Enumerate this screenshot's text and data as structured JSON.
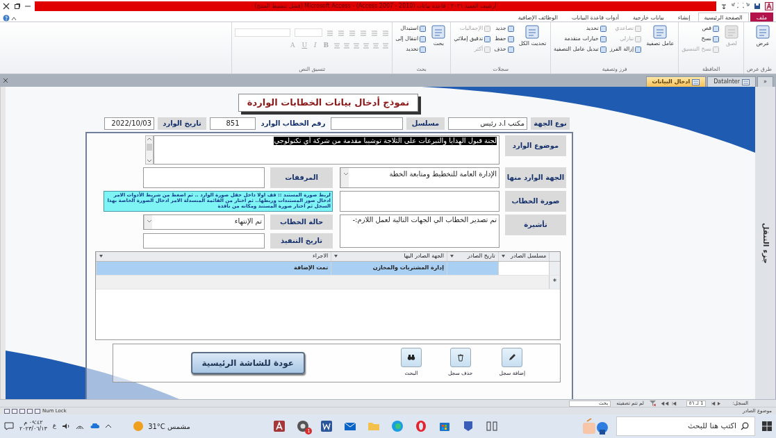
{
  "window": {
    "title": "أرشيف العميد ٢٠٢١ : قاعدة بيانات (Access 2007 - 2010) - Microsoft Access (فشل تنشيط المنتج)"
  },
  "ribbon": {
    "tabs": [
      {
        "label": "ملف",
        "kind": "file",
        "selected": false
      },
      {
        "label": "الصفحة الرئيسية",
        "kind": "tab",
        "selected": true
      },
      {
        "label": "إنشاء",
        "kind": "tab",
        "selected": false
      },
      {
        "label": "بيانات خارجية",
        "kind": "tab",
        "selected": false
      },
      {
        "label": "أدوات قاعدة البيانات",
        "kind": "tab",
        "selected": false
      },
      {
        "label": "الوظائف الإضافية",
        "kind": "tab",
        "selected": false
      }
    ],
    "groups": [
      {
        "label": "طرق عرض",
        "items": [
          {
            "label": "عرض",
            "kind": "large",
            "disabled": false
          }
        ]
      },
      {
        "label": "الحافظة",
        "items": [
          {
            "label": "لصق",
            "kind": "large",
            "disabled": true
          },
          {
            "label": "قص",
            "kind": "small",
            "disabled": false
          },
          {
            "label": "نسخ",
            "kind": "small",
            "disabled": false
          },
          {
            "label": "نسخ التنسيق",
            "kind": "small",
            "disabled": true
          }
        ]
      },
      {
        "label": "فرز وتصفية",
        "items": [
          {
            "label": "عامل تصفية",
            "kind": "large",
            "disabled": false
          },
          {
            "label": "تصاعدي",
            "kind": "small",
            "disabled": true
          },
          {
            "label": "تنازلي",
            "kind": "small",
            "disabled": true
          },
          {
            "label": "إزالة الفرز",
            "kind": "small",
            "disabled": false
          },
          {
            "label": "تحديد",
            "kind": "small",
            "disabled": false
          },
          {
            "label": "خيارات متقدمة",
            "kind": "small",
            "disabled": false
          },
          {
            "label": "تبديل عامل التصفية",
            "kind": "small",
            "disabled": false
          }
        ]
      },
      {
        "label": "سجلات",
        "items": [
          {
            "label": "تحديث الكل",
            "kind": "large",
            "disabled": false
          },
          {
            "label": "جديد",
            "kind": "small",
            "disabled": false
          },
          {
            "label": "حفظ",
            "kind": "small",
            "disabled": false
          },
          {
            "label": "حذف",
            "kind": "small",
            "disabled": false
          },
          {
            "label": "الإجماليات",
            "kind": "small",
            "disabled": true
          },
          {
            "label": "تدقيق إملائي",
            "kind": "small",
            "disabled": false
          },
          {
            "label": "أكثر",
            "kind": "small",
            "disabled": true
          }
        ]
      },
      {
        "label": "بحث",
        "items": [
          {
            "label": "بحث",
            "kind": "large",
            "disabled": false
          },
          {
            "label": "استبدال",
            "kind": "small",
            "disabled": false
          },
          {
            "label": "انتقال إلى",
            "kind": "small",
            "disabled": false
          },
          {
            "label": "تحديد",
            "kind": "small",
            "disabled": false
          }
        ]
      },
      {
        "label": "تنسيق النص",
        "items": [
          {
            "label": "B",
            "kind": "format",
            "disabled": true
          },
          {
            "label": "I",
            "kind": "format",
            "disabled": true
          },
          {
            "label": "U",
            "kind": "format",
            "disabled": true
          },
          {
            "label": "A",
            "kind": "format",
            "disabled": true
          }
        ]
      }
    ]
  },
  "document_tabs": [
    {
      "label": "DataInter",
      "selected": false
    },
    {
      "label": "ادخال البيانات",
      "selected": true
    }
  ],
  "shutter_toggle": "«",
  "form": {
    "title": "نموذج أدخال بيانات الخطابات الواردة",
    "header_fields": [
      {
        "label": "نوع الجهة",
        "value": "مكتب ا.د رئيس"
      },
      {
        "label": "مسلسل"
      },
      {
        "label": "رقم الخطاب الوارد",
        "value": "851"
      },
      {
        "label": "تاريخ الوارد",
        "value": "2022/10/03"
      }
    ],
    "field_rows": [
      [
        {
          "kind": "memo",
          "label": "موضوع الوارد",
          "value": "لجنة قبول الهدايا والتبرعات على الثلاجة توشيبا مقدمة من شركة أي تكنولوجي",
          "selected": true
        }
      ],
      [
        {
          "kind": "combo",
          "label": "الجهة الوارد منها",
          "value": "الإدارة العامة للتخطيط ومتابعة الخطة"
        },
        {
          "kind": "text",
          "label": "المرفقات"
        }
      ],
      [
        {
          "kind": "text",
          "label": "صورة الخطاب"
        },
        {
          "kind": "hint",
          "text": "لربط صورة المستند :: قف اولا داخل حقل صورة الوارد .. ثم اضغط من شريط الأدوات الامر ادخال صور المستندات وربطها.. ثم اختار من القائمة المنسدلة الامر ادخال الصورة الخاصة بهذا السجل ثم اختار صورة المستند ومكانه من نافذة"
        }
      ],
      [
        {
          "kind": "memo",
          "label": "تأشيرة",
          "value": "تم تصدير الخطاب الي الجهات التالية لعمل اللازم:-",
          "selected": false
        },
        {
          "kind": "stack",
          "children": [
            {
              "kind": "combo",
              "label": "حالة الخطاب",
              "value": "تم الإنتهاء"
            },
            {
              "kind": "text",
              "label": "تاريخ التنفيذ"
            }
          ]
        }
      ]
    ],
    "datasheet": {
      "columns": [
        "مسلسل الصادر",
        "تاريخ الصادر",
        "الجهة الصادر اليها",
        "الاجراء"
      ],
      "rows": [
        {
          "cells": [
            "",
            "",
            "إدارة المشتريات والمخازن",
            "تمت الإضافة"
          ],
          "selected": true
        }
      ],
      "new_row_marker": "*"
    },
    "buttons": [
      {
        "kind": "add",
        "label": "إضافة سجل"
      },
      {
        "kind": "delete",
        "label": "حذف سجل"
      },
      {
        "kind": "search",
        "label": "البحث"
      }
    ],
    "back_button": "عودة للشاشة الرئيسية"
  },
  "nav_pane": {
    "label": "جزء التنقل"
  },
  "record_nav": {
    "label": "السجل:",
    "position": "1 لـ ٥٦",
    "filter": "لم تتم تصفيته",
    "search": "بحث"
  },
  "status_bar": {
    "text": "موضوع الصادر",
    "indicator": "Num Lock"
  },
  "taskbar": {
    "search_placeholder": "اكتب هنا للبحث",
    "badge": "1",
    "weather": "31°C مشمس",
    "language": "ع",
    "time": "٠٩:٤٢ م",
    "date": "٢٠٢٣/٠٦/١٣"
  }
}
